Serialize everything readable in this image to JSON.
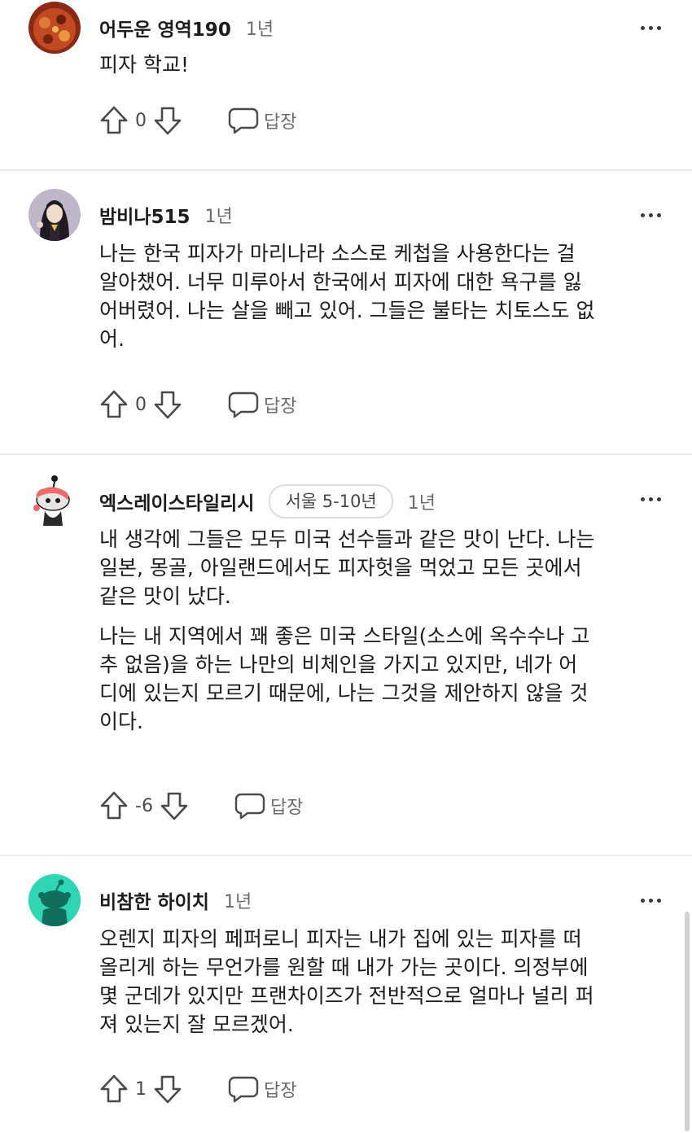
{
  "comments": [
    {
      "username": "어두운 영역190",
      "time": "1년",
      "flair": "",
      "avatar_icon": "pizza-avatar-icon",
      "lines": [
        "피자 학교!"
      ],
      "paragraph2": [],
      "score": "0",
      "reply_label": "답장"
    },
    {
      "username": "밤비나515",
      "time": "1년",
      "flair": "",
      "avatar_icon": "character-avatar-icon",
      "lines": [
        "나는 한국 피자가 마리나라 소스로 케첩을 사용한다는 걸",
        "알아챘어. 너무 미루아서 한국에서 피자에 대한 욕구를 잃",
        "어버렸어. 나는 살을 빼고 있어. 그들은 불타는 치토스도 없",
        "어."
      ],
      "paragraph2": [],
      "score": "0",
      "reply_label": "답장"
    },
    {
      "username": "엑스레이스타일리시",
      "time": "1년",
      "flair": "서울 5-10년",
      "avatar_icon": "snoo-avatar-icon",
      "lines": [
        "내 생각에 그들은 모두 미국 선수들과 같은 맛이 난다. 나는",
        "일본, 몽골, 아일랜드에서도 피자헛을 먹었고 모든 곳에서",
        "같은 맛이 났다."
      ],
      "paragraph2": [
        "나는 내 지역에서 꽤 좋은 미국 스타일(소스에 옥수수나 고",
        "추 없음)을 하는 나만의 비체인을 가지고 있지만, 네가 어",
        "디에 있는지 모르기 때문에, 나는 그것을 제안하지 않을 것",
        "이다."
      ],
      "score": "-6",
      "reply_label": "답장"
    },
    {
      "username": "비참한 하이치",
      "time": "1년",
      "flair": "",
      "avatar_icon": "default-snoo-avatar-icon",
      "lines": [
        "오렌지 피자의 페퍼로니 피자는 내가 집에 있는 피자를 떠",
        "올리게 하는 무언가를 원할 때 내가 가는 곳이다. 의정부에",
        "몇 군데가 있지만 프랜차이즈가 전반적으로 얼마나 널리 퍼",
        "져 있는지 잘 모르겠어."
      ],
      "paragraph2": [],
      "score": "1",
      "reply_label": "답장"
    }
  ],
  "colors": {
    "text": "#1c1c1c",
    "muted": "#6b6b6b",
    "divider": "#e9e9e9",
    "teal_avatar": "#2fd6b3"
  }
}
